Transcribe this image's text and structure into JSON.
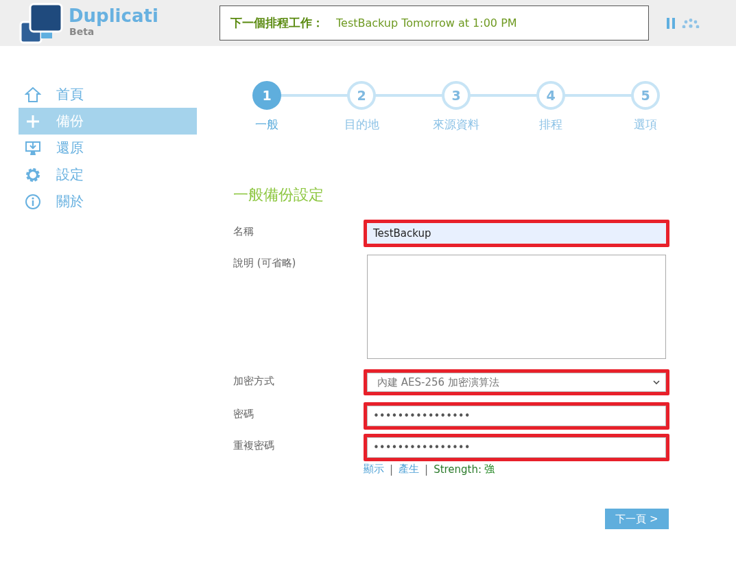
{
  "header": {
    "app_name": "Duplicati",
    "edition": "Beta",
    "next_schedule_label": "下一個排程工作：",
    "next_schedule_value": "TestBackup Tomorrow at 1:00 PM"
  },
  "sidebar": {
    "items": [
      {
        "label": "首頁",
        "selected": false
      },
      {
        "label": "備份",
        "selected": true
      },
      {
        "label": "還原",
        "selected": false
      },
      {
        "label": "設定",
        "selected": false
      },
      {
        "label": "關於",
        "selected": false
      }
    ]
  },
  "steps": [
    {
      "number": "1",
      "label": "一般",
      "selected": true
    },
    {
      "number": "2",
      "label": "目的地",
      "selected": false
    },
    {
      "number": "3",
      "label": "來源資料",
      "selected": false
    },
    {
      "number": "4",
      "label": "排程",
      "selected": false
    },
    {
      "number": "5",
      "label": "選項",
      "selected": false
    }
  ],
  "form": {
    "title": "一般備份設定",
    "fields": [
      {
        "kind": "text",
        "label": "名稱",
        "value": "TestBackup",
        "highlighted": true
      },
      {
        "kind": "textarea",
        "label": "說明 (可省略)",
        "highlighted": false
      },
      {
        "kind": "select",
        "label": "加密方式",
        "value": "內建 AES-256 加密演算法",
        "highlighted": true
      },
      {
        "kind": "password",
        "label": "密碼",
        "value": "••••••••••••••••",
        "highlighted": true
      },
      {
        "kind": "password",
        "label": "重複密碼",
        "value": "••••••••••••••••",
        "highlighted": true
      }
    ],
    "links": [
      {
        "kind": "link",
        "text": "顯示"
      },
      {
        "kind": "separator",
        "text": "|"
      },
      {
        "kind": "link",
        "text": "產生"
      },
      {
        "kind": "separator",
        "text": "|"
      }
    ],
    "strength_label": "Strength:",
    "strength_value": "強",
    "next_button": "下一頁 >"
  }
}
